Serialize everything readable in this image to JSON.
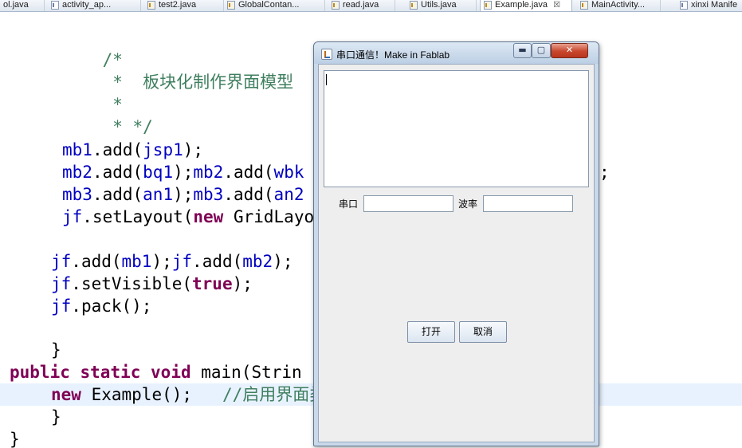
{
  "tabs": [
    {
      "label": "ol.java",
      "type": "java",
      "active": false
    },
    {
      "label": "activity_ap...",
      "type": "xml",
      "active": false
    },
    {
      "label": "test2.java",
      "type": "java",
      "active": false
    },
    {
      "label": "GlobalContan...",
      "type": "java",
      "active": false
    },
    {
      "label": "read.java",
      "type": "java",
      "active": false
    },
    {
      "label": "Utils.java",
      "type": "java",
      "active": false
    },
    {
      "label": "Example.java",
      "type": "java",
      "active": true,
      "close": "☒"
    },
    {
      "label": "MainActivity...",
      "type": "java",
      "active": false
    },
    {
      "label": "xinxi Manife",
      "type": "xml",
      "active": false
    }
  ],
  "code": {
    "comment_open": "/*",
    "comment_body": " *  板块化制作界面模型",
    "comment_star": " *",
    "comment_close": " * */",
    "l_mb1_obj": "mb1",
    "l_mb1_call": ".add(",
    "l_mb1_arg": "jsp1",
    "l_mb1_end": ");",
    "l_mb2_obj1": "mb2",
    "l_mb2_call1": ".add(",
    "l_mb2_arg1": "bq1",
    "l_mb2_mid": ");",
    "l_mb2_obj2": "mb2",
    "l_mb2_call2": ".add(",
    "l_mb2_arg2": "wbk",
    "l_mb2_tail": ";",
    "l_mb3_obj1": "mb3",
    "l_mb3_call1": ".add(",
    "l_mb3_arg1": "an1",
    "l_mb3_mid": ");",
    "l_mb3_obj2": "mb3",
    "l_mb3_call2": ".add(",
    "l_mb3_arg2": "an2",
    "l_layout_obj": "jf",
    "l_layout_call": ".setLayout(",
    "l_layout_kw": "new",
    "l_layout_rest": " GridLayo",
    "l_add_obj1": "jf",
    "l_add_call1": ".add(",
    "l_add_arg1": "mb1",
    "l_add_mid": ");",
    "l_add_obj2": "jf",
    "l_add_call2": ".add(",
    "l_add_arg2": "mb2",
    "l_add_end": ");",
    "l_vis_obj": "jf",
    "l_vis_call": ".setVisible(",
    "l_vis_kw": "true",
    "l_vis_end": ");",
    "l_pack_obj": "jf",
    "l_pack_rest": ".pack();",
    "l_brace1": "}",
    "l_main_kw1": "public",
    "l_main_kw2": "static",
    "l_main_kw3": "void",
    "l_main_rest": " main(Strin",
    "l_new_kw": "new",
    "l_new_rest": " Example();   ",
    "l_new_comment": "//启用界面类",
    "l_brace2": "}",
    "l_brace3": "}"
  },
  "dialog": {
    "title": "串口通信！Make in Fablab",
    "min_glyph": "▬",
    "max_glyph": "▢",
    "close_glyph": "✕",
    "textarea_value": "",
    "port_label": "串口",
    "port_value": "",
    "baud_label": "波率",
    "baud_value": "",
    "open_button": "打开",
    "cancel_button": "取消"
  }
}
